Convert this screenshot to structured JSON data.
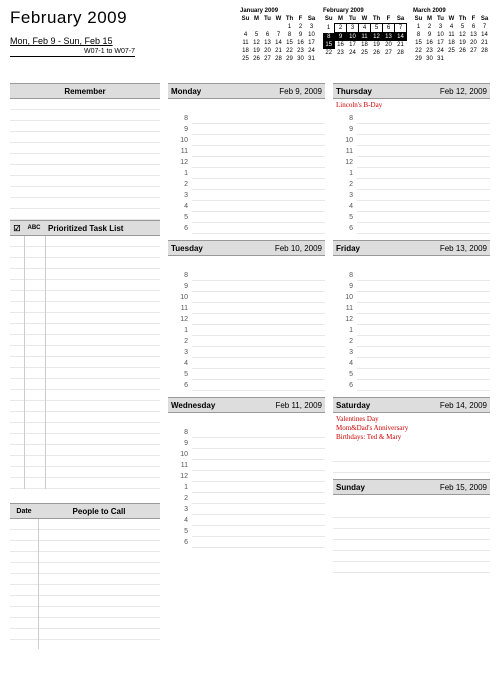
{
  "header": {
    "month_title": "February 2009",
    "date_range": "Mon, Feb 9  -  Sun, Feb 15",
    "week_code": "W07-1 to W07-7"
  },
  "mini_cals": [
    {
      "title": "January 2009",
      "dow": [
        "Su",
        "M",
        "Tu",
        "W",
        "Th",
        "F",
        "Sa"
      ],
      "rows": [
        [
          "",
          "",
          "",
          "",
          "1",
          "2",
          "3"
        ],
        [
          "4",
          "5",
          "6",
          "7",
          "8",
          "9",
          "10"
        ],
        [
          "11",
          "12",
          "13",
          "14",
          "15",
          "16",
          "17"
        ],
        [
          "18",
          "19",
          "20",
          "21",
          "22",
          "23",
          "24"
        ],
        [
          "25",
          "26",
          "27",
          "28",
          "29",
          "30",
          "31"
        ]
      ],
      "hl": "none"
    },
    {
      "title": "February 2009",
      "dow": [
        "Su",
        "M",
        "Tu",
        "W",
        "Th",
        "F",
        "Sa"
      ],
      "rows": [
        [
          "1",
          "2",
          "3",
          "4",
          "5",
          "6",
          "7"
        ],
        [
          "8",
          "9",
          "10",
          "11",
          "12",
          "13",
          "14"
        ],
        [
          "15",
          "16",
          "17",
          "18",
          "19",
          "20",
          "21"
        ],
        [
          "22",
          "23",
          "24",
          "25",
          "26",
          "27",
          "28"
        ],
        [
          "",
          "",
          "",
          "",
          "",
          "",
          ""
        ]
      ],
      "hl": "week2"
    },
    {
      "title": "March 2009",
      "dow": [
        "Su",
        "M",
        "Tu",
        "W",
        "Th",
        "F",
        "Sa"
      ],
      "rows": [
        [
          "1",
          "2",
          "3",
          "4",
          "5",
          "6",
          "7"
        ],
        [
          "8",
          "9",
          "10",
          "11",
          "12",
          "13",
          "14"
        ],
        [
          "15",
          "16",
          "17",
          "18",
          "19",
          "20",
          "21"
        ],
        [
          "22",
          "23",
          "24",
          "25",
          "26",
          "27",
          "28"
        ],
        [
          "29",
          "30",
          "31",
          "",
          "",
          "",
          ""
        ]
      ],
      "hl": "none"
    }
  ],
  "sidebar": {
    "remember_label": "Remember",
    "task_check": "☑",
    "task_abc": "ABC",
    "task_label": "Prioritized Task List",
    "people_date": "Date",
    "people_label": "People to Call"
  },
  "hours": [
    "8",
    "9",
    "10",
    "11",
    "12",
    "1",
    "2",
    "3",
    "4",
    "5",
    "6"
  ],
  "days_col1": [
    {
      "name": "Monday",
      "date": "Feb 9, 2009",
      "events": []
    },
    {
      "name": "Tuesday",
      "date": "Feb 10, 2009",
      "events": []
    },
    {
      "name": "Wednesday",
      "date": "Feb 11, 2009",
      "events": []
    }
  ],
  "days_col2": [
    {
      "name": "Thursday",
      "date": "Feb 12, 2009",
      "events": [
        "Lincoln's B-Day"
      ]
    },
    {
      "name": "Friday",
      "date": "Feb 13, 2009",
      "events": []
    },
    {
      "name": "Saturday",
      "date": "Feb 14, 2009",
      "events": [
        "Valentines Day",
        "Mom&Dad's Anniversary",
        "Birthdays: Ted & Mary"
      ],
      "short": true
    },
    {
      "name": "Sunday",
      "date": "Feb 15, 2009",
      "events": [],
      "sunday": true
    }
  ]
}
